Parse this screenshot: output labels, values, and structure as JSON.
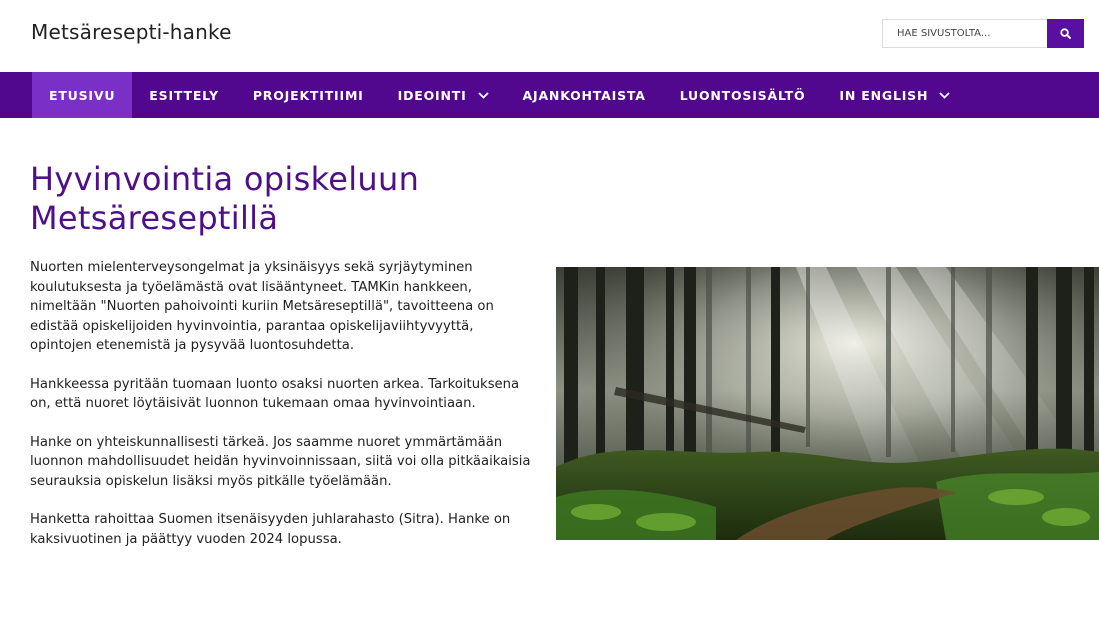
{
  "header": {
    "site_title": "Metsäresepti-hanke",
    "search_placeholder": "HAE SIVUSTOLTA..."
  },
  "nav": {
    "items": [
      {
        "label": "ETUSIVU",
        "active": true
      },
      {
        "label": "ESITTELY"
      },
      {
        "label": "PROJEKTITIIMI"
      },
      {
        "label": "IDEOINTI",
        "dropdown": true
      },
      {
        "label": "AJANKOHTAISTA"
      },
      {
        "label": "LUONTOSISÄLTÖ"
      },
      {
        "label": "IN ENGLISH",
        "dropdown": true
      }
    ]
  },
  "main": {
    "title": "Hyvinvointia opiskeluun Metsäreseptillä",
    "paragraphs": [
      "Nuorten mielenterveysongelmat ja yksinäisyys sekä syrjäytyminen koulutuksesta ja työelämästä ovat lisääntyneet. TAMKin hankkeen, nimeltään \"Nuorten pahoivointi kuriin Metsäreseptillä\", tavoitteena on edistää opiskelijoiden hyvinvointia, parantaa opiskelijaviihtyvyyttä, opintojen etenemistä ja pysyvää luontosuhdetta.",
      "Hankkeessa pyritään tuomaan luonto osaksi nuorten arkea. Tarkoituksena on, että nuoret löytäisivät luonnon tukemaan omaa hyvinvointiaan.",
      "Hanke on yhteiskunnallisesti tärkeä. Jos saamme nuoret ymmärtämään luonnon mahdollisuudet heidän hyvinvoinnissaan, siitä voi olla pitkäaikaisia seurauksia opiskelun lisäksi myös pitkälle työelämään.",
      "Hanketta rahoittaa Suomen itsenäisyyden juhlarahasto (Sitra). Hanke on kaksivuotinen ja päättyy vuoden 2024 lopussa."
    ]
  },
  "icons": {
    "search": "search-icon",
    "dropdown": "chevron-down-icon"
  },
  "colors": {
    "nav_bg": "#52088e",
    "nav_active": "#7a2fc7",
    "title": "#4e0f87",
    "search_button": "#5a0fa0"
  }
}
